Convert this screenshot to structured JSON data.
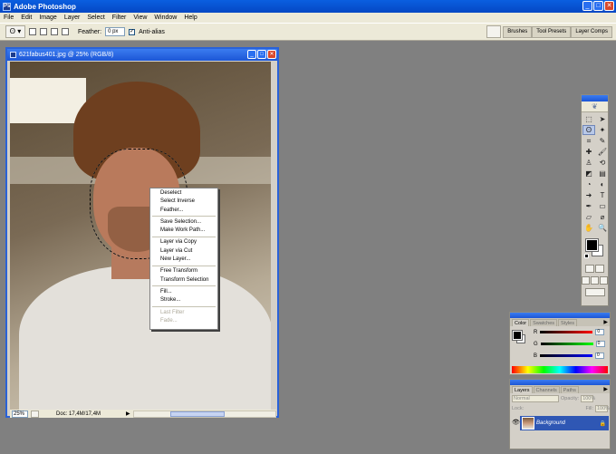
{
  "app": {
    "title": "Adobe Photoshop",
    "icon": "Ps"
  },
  "window_controls": {
    "minimize": "_",
    "maximize": "□",
    "close": "✕"
  },
  "menu": [
    "File",
    "Edit",
    "Image",
    "Layer",
    "Select",
    "Filter",
    "View",
    "Window",
    "Help"
  ],
  "options": {
    "tool_icon": "lasso-icon",
    "feather_label": "Feather:",
    "feather_value": "0 px",
    "antialias_label": "Anti-alias",
    "antialias_checked": true,
    "palette_well_tabs": [
      "Brushes",
      "Tool Presets",
      "Layer Comps"
    ]
  },
  "document": {
    "title": "621fabus401.jpg @ 25% (RGB/8)",
    "zoom": "25%",
    "doc_size": "Doc: 17,4M/17,4M"
  },
  "context_menu": {
    "groups": [
      [
        "Deselect",
        "Select Inverse",
        "Feather..."
      ],
      [
        "Save Selection...",
        "Make Work Path..."
      ],
      [
        "Layer via Copy",
        "Layer via Cut",
        "New Layer..."
      ],
      [
        "Free Transform",
        "Transform Selection"
      ],
      [
        "Fill...",
        "Stroke..."
      ]
    ],
    "disabled_group": [
      "Last Filter",
      "Fade..."
    ]
  },
  "toolbox": {
    "tools": [
      "rectangular-marquee-icon",
      "move-icon",
      "lasso-icon",
      "magic-wand-icon",
      "crop-icon",
      "slice-icon",
      "healing-brush-icon",
      "brush-icon",
      "clone-stamp-icon",
      "history-brush-icon",
      "eraser-icon",
      "gradient-icon",
      "blur-icon",
      "dodge-icon",
      "path-selection-icon",
      "type-icon",
      "pen-icon",
      "shape-icon",
      "notes-icon",
      "eyedropper-icon",
      "hand-icon",
      "zoom-icon"
    ],
    "glyphs": [
      "⬚",
      "➤",
      "ʘ",
      "✦",
      "⌗",
      "✎",
      "✚",
      "🖌",
      "♙",
      "⟲",
      "◩",
      "▤",
      "◔",
      "◐",
      "➜",
      "T",
      "✒",
      "▭",
      "▱",
      "⌀",
      "✋",
      "🔍"
    ],
    "foreground": "#000000",
    "background": "#ffffff"
  },
  "color_palette": {
    "tabs": [
      "Color",
      "Swatches",
      "Styles"
    ],
    "channels": [
      {
        "label": "R",
        "value": "0"
      },
      {
        "label": "G",
        "value": "0"
      },
      {
        "label": "B",
        "value": "0"
      }
    ]
  },
  "layers_palette": {
    "tabs": [
      "Layers",
      "Channels",
      "Paths"
    ],
    "blend_mode": "Normal",
    "opacity_label": "Opacity:",
    "opacity": "100%",
    "lock_label": "Lock:",
    "fill_label": "Fill:",
    "fill": "100%",
    "layers": [
      {
        "name": "Background",
        "visible": true,
        "locked": true
      }
    ]
  },
  "colors": {
    "accent": "#2a62d8",
    "selection": "#2f57b4",
    "chrome": "#ece9d8",
    "workspace": "#808080"
  }
}
